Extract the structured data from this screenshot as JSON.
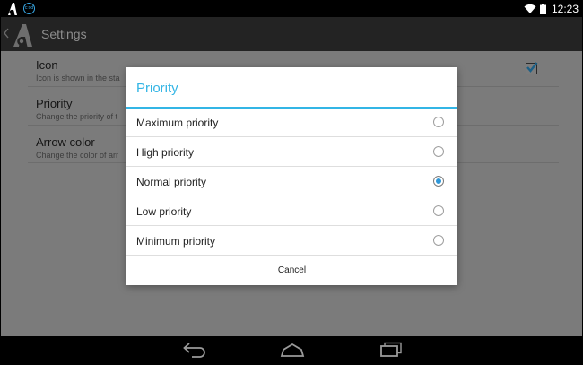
{
  "status_bar": {
    "time": "12:23",
    "app_icon": "app-logo-icon",
    "notification_icon": "ring-badge-icon",
    "notification_text": "c:od",
    "wifi_icon": "wifi-icon",
    "battery_icon": "battery-icon"
  },
  "action_bar": {
    "title": "Settings",
    "back_icon": "chevron-left-icon",
    "logo_icon": "app-logo-icon"
  },
  "preferences": [
    {
      "title": "Icon",
      "summary": "Icon is shown in the sta"
    },
    {
      "title": "Priority",
      "summary": "Change the priority of t"
    },
    {
      "title": "Arrow color",
      "summary": "Change the color of arr"
    }
  ],
  "icon_pref_checked": true,
  "dialog": {
    "title": "Priority",
    "options": [
      {
        "label": "Maximum priority",
        "selected": false
      },
      {
        "label": "High priority",
        "selected": false
      },
      {
        "label": "Normal priority",
        "selected": true
      },
      {
        "label": "Low priority",
        "selected": false
      },
      {
        "label": "Minimum priority",
        "selected": false
      }
    ],
    "cancel_label": "Cancel"
  },
  "nav_bar": {
    "back_icon": "nav-back-icon",
    "home_icon": "nav-home-icon",
    "recents_icon": "nav-recents-icon"
  },
  "colors": {
    "accent": "#33b5e5",
    "radio_selected": "#2e97d8",
    "dim_background": "#7b7b7b"
  }
}
